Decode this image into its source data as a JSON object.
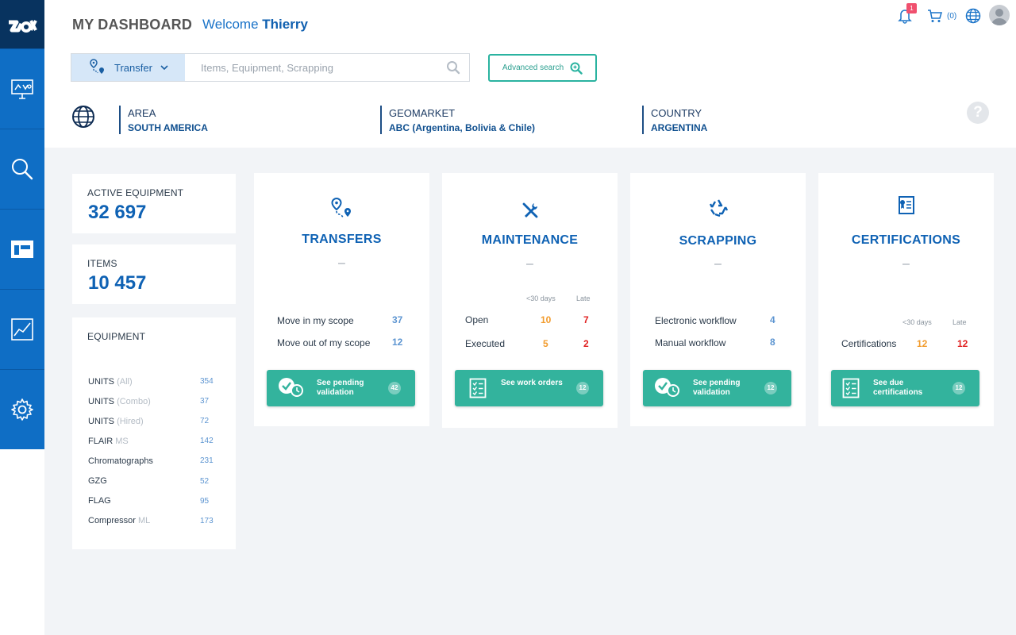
{
  "header": {
    "title": "MY DASHBOARD",
    "welcome_prefix": "Welcome",
    "user_name": "Thierry",
    "notifications_count": "1",
    "cart_count": "(0)"
  },
  "search": {
    "mode_label": "Transfer",
    "placeholder": "Items, Equipment, Scrapping",
    "advanced_label": "Advanced search"
  },
  "location": {
    "area_label": "AREA",
    "area_value": "SOUTH AMERICA",
    "geomarket_label": "GEOMARKET",
    "geomarket_value": "ABC (Argentina, Bolivia & Chile)",
    "country_label": "COUNTRY",
    "country_value": "ARGENTINA",
    "help": "?"
  },
  "stats": {
    "active_equipment_label": "ACTIVE EQUIPMENT",
    "active_equipment_value": "32 697",
    "items_label": "ITEMS",
    "items_value": "10 457"
  },
  "equipment": {
    "title": "EQUIPMENT",
    "rows": [
      {
        "name": "UNITS",
        "qualifier": "(All)",
        "count": "354"
      },
      {
        "name": "UNITS",
        "qualifier": "(Combo)",
        "count": "37"
      },
      {
        "name": "UNITS",
        "qualifier": "(Hired)",
        "count": "72"
      },
      {
        "name": "FLAIR",
        "qualifier": "MS",
        "count": "142"
      },
      {
        "name": "Chromatographs",
        "qualifier": "",
        "count": "231"
      },
      {
        "name": "GZG",
        "qualifier": "",
        "count": "52"
      },
      {
        "name": "FLAG",
        "qualifier": "",
        "count": "95"
      },
      {
        "name": "Compressor",
        "qualifier": "ML",
        "count": "173"
      }
    ]
  },
  "modules": {
    "transfers": {
      "title": "TRANSFERS",
      "dash": "–",
      "row1_label": "Move in my scope",
      "row1_value": "37",
      "row2_label": "Move out of my scope",
      "row2_value": "12",
      "button_label": "See pending validation",
      "button_count": "42"
    },
    "maintenance": {
      "title": "MAINTENANCE",
      "dash": "–",
      "col1_header": "<30 days",
      "col2_header": "Late",
      "row1_label": "Open",
      "row1_v1": "10",
      "row1_v2": "7",
      "row2_label": "Executed",
      "row2_v1": "5",
      "row2_v2": "2",
      "button_label": "See work orders",
      "button_count": "12"
    },
    "scrapping": {
      "title": "SCRAPPING",
      "dash": "–",
      "row1_label": "Electronic workflow",
      "row1_value": "4",
      "row2_label": "Manual workflow",
      "row2_value": "8",
      "button_label": "See pending validation",
      "button_count": "12"
    },
    "certifications": {
      "title": "CERTIFICATIONS",
      "dash": "–",
      "col1_header": "<30 days",
      "col2_header": "Late",
      "row1_label": "Certifications",
      "row1_v1": "12",
      "row1_v2": "12",
      "button_label": "See due certifications",
      "button_count": "12"
    }
  },
  "colors": {
    "primary": "#0f6ec5",
    "dark_navy": "#08335f",
    "teal": "#33b39d",
    "orange": "#f29b2c",
    "red": "#e02020"
  },
  "icons": {
    "sidebar": [
      "presentation-icon",
      "search-icon",
      "dashboard-icon",
      "chart-icon",
      "settings-icon"
    ]
  }
}
